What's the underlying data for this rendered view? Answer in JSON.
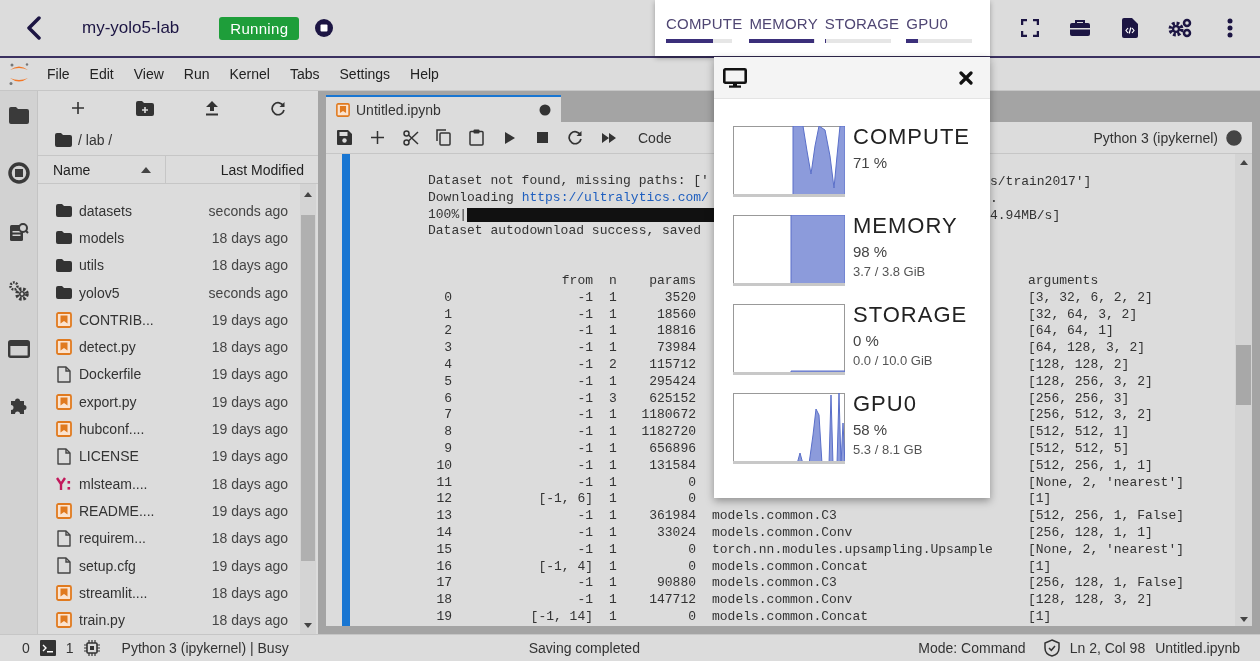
{
  "header": {
    "title": "my-yolo5-lab",
    "status": "Running"
  },
  "resource_meters": [
    {
      "label": "COMPUTE",
      "level": 0.71
    },
    {
      "label": "MEMORY",
      "level": 0.98
    },
    {
      "label": "STORAGE",
      "level": 0.0
    },
    {
      "label": "GPU0",
      "level": 0.17
    }
  ],
  "menu": [
    "File",
    "Edit",
    "View",
    "Run",
    "Kernel",
    "Tabs",
    "Settings",
    "Help"
  ],
  "file_browser": {
    "breadcrumb": "/ lab /",
    "columns": [
      {
        "label": "Name",
        "sorted": true
      },
      {
        "label": "Last Modified",
        "sorted": false
      }
    ],
    "files": [
      {
        "name": "datasets",
        "modified": "seconds ago",
        "kind": "folder"
      },
      {
        "name": "models",
        "modified": "18 days ago",
        "kind": "folder"
      },
      {
        "name": "utils",
        "modified": "18 days ago",
        "kind": "folder"
      },
      {
        "name": "yolov5",
        "modified": "seconds ago",
        "kind": "folder"
      },
      {
        "name": "CONTRIB...",
        "modified": "19 days ago",
        "kind": "code"
      },
      {
        "name": "detect.py",
        "modified": "18 days ago",
        "kind": "code"
      },
      {
        "name": "Dockerfile",
        "modified": "19 days ago",
        "kind": "file"
      },
      {
        "name": "export.py",
        "modified": "19 days ago",
        "kind": "code"
      },
      {
        "name": "hubconf....",
        "modified": "19 days ago",
        "kind": "code"
      },
      {
        "name": "LICENSE",
        "modified": "19 days ago",
        "kind": "file"
      },
      {
        "name": "mlsteam....",
        "modified": "18 days ago",
        "kind": "yaml"
      },
      {
        "name": "README....",
        "modified": "19 days ago",
        "kind": "code"
      },
      {
        "name": "requirem...",
        "modified": "18 days ago",
        "kind": "file"
      },
      {
        "name": "setup.cfg",
        "modified": "19 days ago",
        "kind": "file"
      },
      {
        "name": "streamlit....",
        "modified": "18 days ago",
        "kind": "code"
      },
      {
        "name": "train.py",
        "modified": "18 days ago",
        "kind": "code"
      }
    ]
  },
  "notebook": {
    "tab": {
      "title": "Untitled.ipynb",
      "dirty": true
    },
    "cell_type": "Code",
    "kernel": "Python 3 (ipykernel)",
    "kernel_busy": true,
    "output_lines": [
      {
        "kind": "text",
        "text": "Dataset not found, missing paths: ['",
        "right": "s/train2017']"
      },
      {
        "kind": "link",
        "text": "Downloading ",
        "link": "https://ultralytics.com/",
        "right": "."
      },
      {
        "kind": "progress",
        "text": "100%|",
        "level": 1,
        "right": "4.94MB/s]"
      },
      {
        "kind": "text",
        "text": "Dataset autodownload success, saved"
      }
    ],
    "table": {
      "columns": [
        "from",
        "n",
        "params",
        "arguments"
      ],
      "rows": [
        {
          "index": "0",
          "from": "-1",
          "n": "1",
          "params": "3520",
          "arguments": "[3, 32, 6, 2, 2]"
        },
        {
          "index": "1",
          "from": "-1",
          "n": "1",
          "params": "18560",
          "arguments": "[32, 64, 3, 2]"
        },
        {
          "index": "2",
          "from": "-1",
          "n": "1",
          "params": "18816",
          "arguments": "[64, 64, 1]"
        },
        {
          "index": "3",
          "from": "-1",
          "n": "1",
          "params": "73984",
          "arguments": "[64, 128, 3, 2]"
        },
        {
          "index": "4",
          "from": "-1",
          "n": "2",
          "params": "115712",
          "arguments": "[128, 128, 2]"
        },
        {
          "index": "5",
          "from": "-1",
          "n": "1",
          "params": "295424",
          "arguments": "[128, 256, 3, 2]"
        },
        {
          "index": "6",
          "from": "-1",
          "n": "3",
          "params": "625152",
          "arguments": "[256, 256, 3]"
        },
        {
          "index": "7",
          "from": "-1",
          "n": "1",
          "params": "1180672",
          "arguments": "[256, 512, 3, 2]"
        },
        {
          "index": "8",
          "from": "-1",
          "n": "1",
          "params": "1182720",
          "arguments": "[512, 512, 1]"
        },
        {
          "index": "9",
          "from": "-1",
          "n": "1",
          "params": "656896",
          "arguments": "[512, 512, 5]"
        },
        {
          "index": "10",
          "from": "-1",
          "n": "1",
          "params": "131584",
          "arguments": "[512, 256, 1, 1]"
        },
        {
          "index": "11",
          "from": "-1",
          "n": "1",
          "params": "0",
          "arguments": "[None, 2, 'nearest']"
        },
        {
          "index": "12",
          "from": "[-1, 6]",
          "n": "1",
          "params": "0",
          "arguments": "[1]"
        },
        {
          "index": "13",
          "from": "-1",
          "n": "1",
          "params": "361984",
          "module": "models.common.C3",
          "arguments": "[512, 256, 1, False]"
        },
        {
          "index": "14",
          "from": "-1",
          "n": "1",
          "params": "33024",
          "module": "models.common.Conv",
          "arguments": "[256, 128, 1, 1]"
        },
        {
          "index": "15",
          "from": "-1",
          "n": "1",
          "params": "0",
          "module": "torch.nn.modules.upsampling.Upsample",
          "arguments": "[None, 2, 'nearest']"
        },
        {
          "index": "16",
          "from": "[-1, 4]",
          "n": "1",
          "params": "0",
          "module": "models.common.Concat",
          "arguments": "[1]"
        },
        {
          "index": "17",
          "from": "-1",
          "n": "1",
          "params": "90880",
          "module": "models.common.C3",
          "arguments": "[256, 128, 1, False]"
        },
        {
          "index": "18",
          "from": "-1",
          "n": "1",
          "params": "147712",
          "module": "models.common.Conv",
          "arguments": "[128, 128, 3, 2]"
        },
        {
          "index": "19",
          "from": "[-1, 14]",
          "n": "1",
          "params": "0",
          "module": "models.common.Concat",
          "arguments": "[1]"
        }
      ]
    }
  },
  "resource_popup": {
    "cards": [
      {
        "name": "COMPUTE",
        "percent": "71 %"
      },
      {
        "name": "MEMORY",
        "percent": "98 %",
        "detail": "3.7 / 3.8 GiB"
      },
      {
        "name": "STORAGE",
        "percent": "0 %",
        "detail": "0.0 / 10.0 GiB"
      },
      {
        "name": "GPU0",
        "percent": "58 %",
        "detail": "5.3 / 8.1 GB"
      }
    ]
  },
  "status_bar": {
    "terminals": "0",
    "kernels": "1",
    "kernel_status": "Python 3 (ipykernel) | Busy",
    "message": "Saving completed",
    "mode": "Mode: Command",
    "cursor": "Ln 2, Col 98",
    "file": "Untitled.ipynb"
  }
}
